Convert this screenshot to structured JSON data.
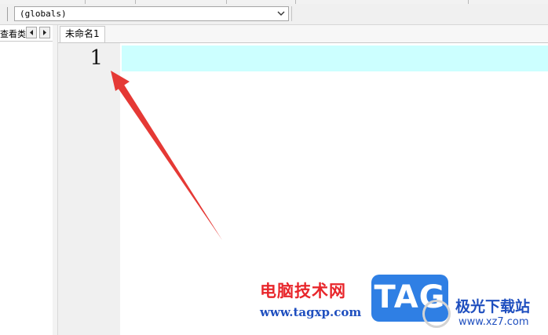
{
  "toolbar": {
    "scope_combo_value": "(globals)"
  },
  "left_panel": {
    "tab_label": "查看类",
    "scroll_left_icon": "triangle-left-icon",
    "scroll_right_icon": "triangle-right-icon"
  },
  "document_tabs": [
    {
      "label": "未命名1",
      "active": true
    }
  ],
  "editor": {
    "line_numbers": [
      "1"
    ],
    "current_line_highlight_color": "#ccffff",
    "gutter_color": "#f0f0f0"
  },
  "annotation": {
    "arrow_color": "#e53935"
  },
  "watermark": {
    "brand_cn": "电脑技术网",
    "brand_url": "www.tagxp.com",
    "logo_text": "TAG",
    "site_cn": "极光下载站",
    "site_url": "www.xz7.com",
    "brand_red": "#e8262b",
    "brand_blue": "#2f7fe4"
  }
}
